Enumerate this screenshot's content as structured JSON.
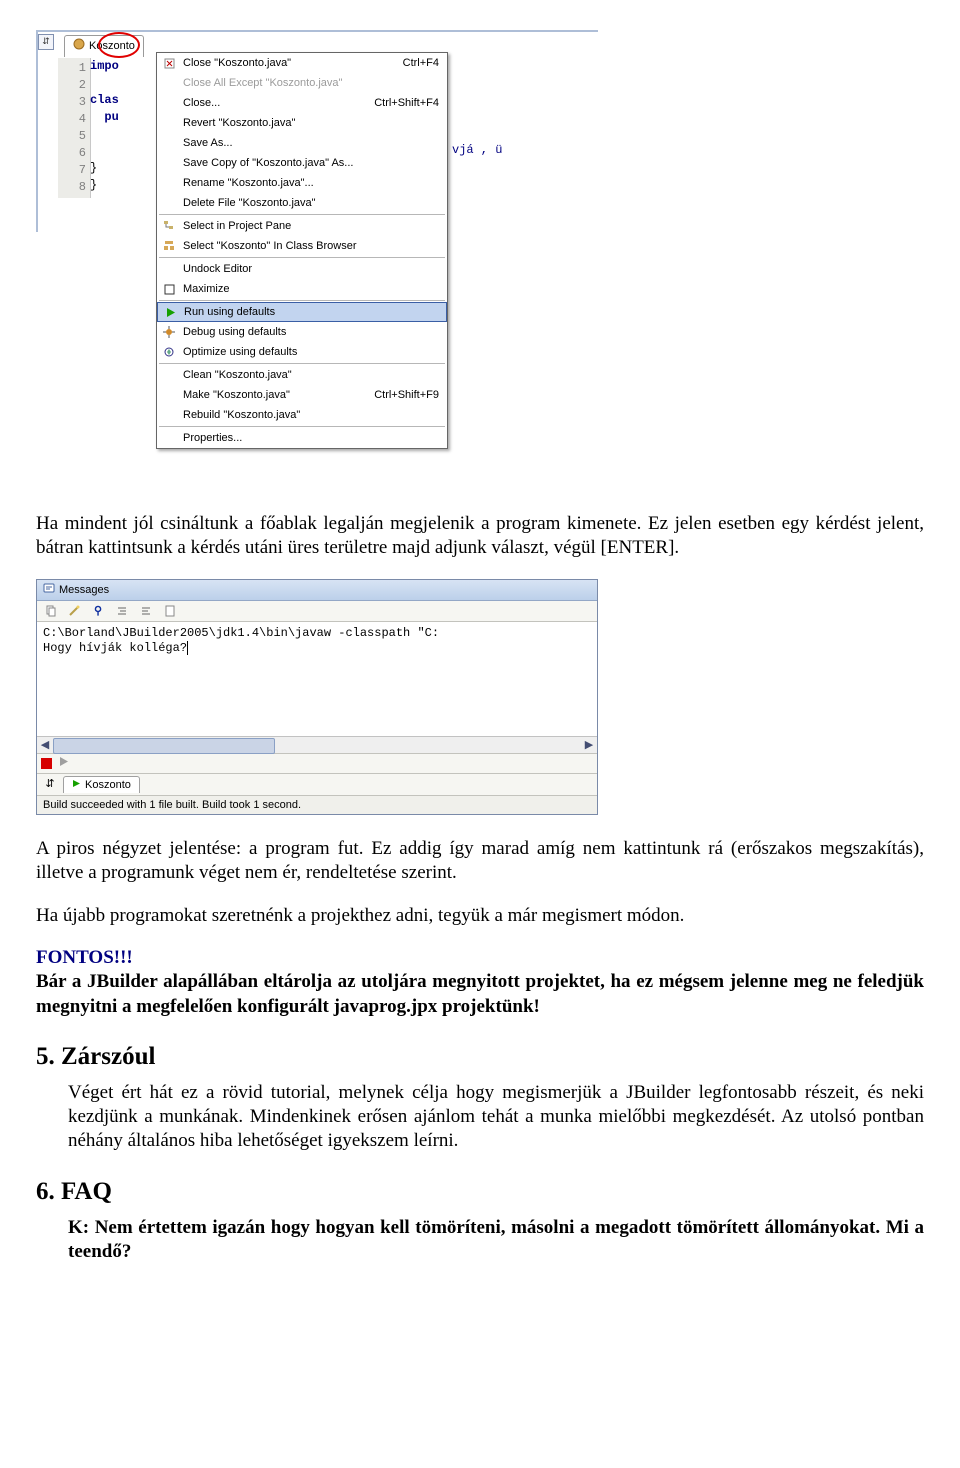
{
  "ide": {
    "tab_label": "Koszonto",
    "gutter_lines": [
      "1",
      "2",
      "3",
      "4",
      "5",
      "6",
      "7",
      "8"
    ],
    "code_tokens": [
      "impo",
      "",
      "clas",
      "  pu",
      "",
      "",
      "}",
      "}"
    ],
    "code_fragment": "vjá\n, ü"
  },
  "context_menu": {
    "items": [
      {
        "label": "Close \"Koszonto.java\"",
        "shortcut": "Ctrl+F4",
        "icon": "close"
      },
      {
        "label": "Close All Except \"Koszonto.java\"",
        "disabled": true
      },
      {
        "label": "Close...",
        "shortcut": "Ctrl+Shift+F4"
      },
      {
        "label": "Revert \"Koszonto.java\""
      },
      {
        "label": "Save As..."
      },
      {
        "label": "Save Copy of \"Koszonto.java\" As..."
      },
      {
        "label": "Rename \"Koszonto.java\"..."
      },
      {
        "label": "Delete File \"Koszonto.java\""
      },
      {
        "sep": true
      },
      {
        "label": "Select in Project Pane",
        "icon": "tree"
      },
      {
        "label": "Select \"Koszonto\" In Class Browser",
        "icon": "classbrowser"
      },
      {
        "sep": true
      },
      {
        "label": "Undock Editor"
      },
      {
        "label": "Maximize",
        "icon": "maximize"
      },
      {
        "sep": true
      },
      {
        "label": "Run using defaults",
        "icon": "run",
        "highlight": true
      },
      {
        "label": "Debug using defaults",
        "icon": "debug"
      },
      {
        "label": "Optimize using defaults",
        "icon": "optimize"
      },
      {
        "sep": true
      },
      {
        "label": "Clean \"Koszonto.java\""
      },
      {
        "label": "Make \"Koszonto.java\"",
        "shortcut": "Ctrl+Shift+F9"
      },
      {
        "label": "Rebuild \"Koszonto.java\""
      },
      {
        "sep": true
      },
      {
        "label": "Properties..."
      }
    ]
  },
  "messages": {
    "title": "Messages",
    "console_line1": "C:\\Borland\\JBuilder2005\\jdk1.4\\bin\\javaw -classpath \"C:",
    "console_line2": "Hogy hívják kolléga?",
    "tab_label": "Koszonto",
    "status": "Build succeeded with 1 file built.  Build took 1 second."
  },
  "doc": {
    "p1": "Ha mindent jól csináltunk a főablak legalján megjelenik a program kimenete. Ez jelen esetben egy kérdést jelent, bátran kattintsunk a kérdés utáni üres területre majd adjunk választ, végül [ENTER].",
    "p2": "A piros négyzet jelentése: a program fut. Ez addig így marad amíg nem kattintunk rá (erőszakos megszakítás), illetve a programunk véget nem ér, rendeltetése szerint.",
    "p3": "Ha újabb programokat szeretnénk a projekthez adni, tegyük a már megismert módon.",
    "fontos": "FONTOS!!!",
    "p4": "Bár a JBuilder alapállában eltárolja az utoljára megnyitott projektet, ha ez mégsem jelenne meg ne feledjük megnyitni a megfelelően konfigurált javaprog.jpx projektünk!",
    "h5": "5. Zárszóul",
    "p5": "Véget ért hát ez a rövid tutorial, melynek célja hogy megismerjük a JBuilder legfontosabb részeit, és neki kezdjünk a munkának. Mindenkinek erősen ajánlom tehát a munka mielőbbi megkezdését. Az utolsó pontban néhány általános hiba lehetőséget igyekszem leírni.",
    "h6": "6. FAQ",
    "p6a": "K: Nem értettem igazán hogy hogyan kell tömöríteni, másolni a megadott tömörített állományokat. Mi a teendő?"
  }
}
